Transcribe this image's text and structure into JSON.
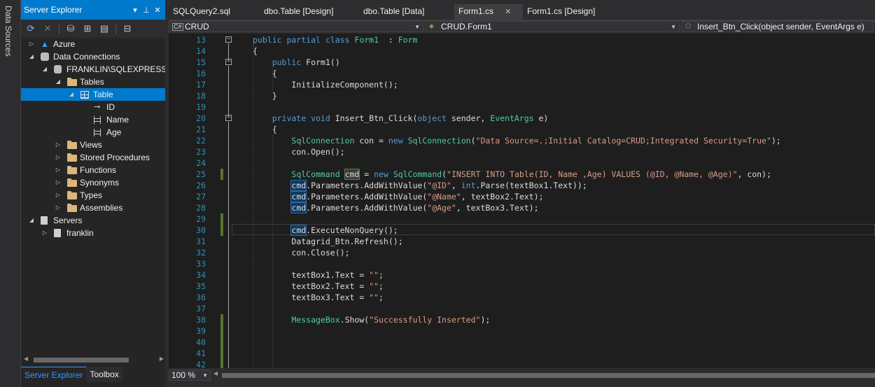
{
  "left_strip": {
    "data_sources": "Data Sources"
  },
  "server_explorer": {
    "title": "Server Explorer",
    "toolbar_icons": [
      "refresh-icon",
      "stop-icon",
      "connect-database-icon",
      "connect-server-icon",
      "sharepoint-icon",
      "properties-icon"
    ],
    "tree": [
      {
        "label": "Azure",
        "level": 0,
        "arrow": "collapsed",
        "icon": "azure-icon"
      },
      {
        "label": "Data Connections",
        "level": 0,
        "arrow": "expanded",
        "icon": "data-connections-icon"
      },
      {
        "label": "FRANKLIN\\SQLEXPRESS.C",
        "level": 1,
        "arrow": "expanded",
        "icon": "database-icon"
      },
      {
        "label": "Tables",
        "level": 2,
        "arrow": "expanded",
        "icon": "folder-icon"
      },
      {
        "label": "Table",
        "level": 3,
        "arrow": "expanded",
        "icon": "table-icon",
        "selected": true
      },
      {
        "label": "ID",
        "level": 4,
        "arrow": "none",
        "icon": "key-column-icon"
      },
      {
        "label": "Name",
        "level": 4,
        "arrow": "none",
        "icon": "column-icon"
      },
      {
        "label": "Age",
        "level": 4,
        "arrow": "none",
        "icon": "column-icon"
      },
      {
        "label": "Views",
        "level": 2,
        "arrow": "collapsed",
        "icon": "folder-icon"
      },
      {
        "label": "Stored Procedures",
        "level": 2,
        "arrow": "collapsed",
        "icon": "folder-icon"
      },
      {
        "label": "Functions",
        "level": 2,
        "arrow": "collapsed",
        "icon": "folder-icon"
      },
      {
        "label": "Synonyms",
        "level": 2,
        "arrow": "collapsed",
        "icon": "folder-icon"
      },
      {
        "label": "Types",
        "level": 2,
        "arrow": "collapsed",
        "icon": "folder-icon"
      },
      {
        "label": "Assemblies",
        "level": 2,
        "arrow": "collapsed",
        "icon": "folder-icon"
      },
      {
        "label": "Servers",
        "level": 0,
        "arrow": "expanded",
        "icon": "servers-icon"
      },
      {
        "label": "franklin",
        "level": 1,
        "arrow": "collapsed",
        "icon": "server-icon"
      }
    ],
    "bottom_tabs": [
      {
        "label": "Server Explorer",
        "active": true
      },
      {
        "label": "Toolbox",
        "active": false
      }
    ]
  },
  "document_tabs": [
    {
      "label": "SQLQuery2.sql",
      "active": false
    },
    {
      "label": "dbo.Table [Design]",
      "active": false
    },
    {
      "label": "dbo.Table [Data]",
      "active": false
    },
    {
      "label": "Form1.cs",
      "active": true,
      "close": "✕"
    },
    {
      "label": "Form1.cs [Design]",
      "active": false
    }
  ],
  "navigation": {
    "project": "CRUD",
    "class": "CRUD.Form1",
    "member": "Insert_Btn_Click(object sender, EventArgs e)"
  },
  "editor": {
    "line_numbers": [
      "13",
      "14",
      "15",
      "16",
      "17",
      "18",
      "19",
      "20",
      "21",
      "22",
      "23",
      "24",
      "25",
      "26",
      "27",
      "28",
      "29",
      "30",
      "31",
      "32",
      "33",
      "34",
      "35",
      "36",
      "37",
      "38",
      "39",
      "40",
      "41",
      "42"
    ],
    "code_lines": [
      [
        [
          "kw",
          "public partial class "
        ],
        [
          "ty",
          "Form1"
        ],
        [
          "",
          "  : "
        ],
        [
          "ty",
          "Form"
        ]
      ],
      [
        [
          "",
          "{"
        ]
      ],
      [
        [
          "kw",
          "    public "
        ],
        [
          "",
          "Form1()"
        ]
      ],
      [
        [
          "",
          "    {"
        ]
      ],
      [
        [
          "",
          "        InitializeComponent();"
        ]
      ],
      [
        [
          "",
          "    }"
        ]
      ],
      [
        [
          "",
          ""
        ]
      ],
      [
        [
          "kw",
          "    private void "
        ],
        [
          "",
          "Insert_Btn_Click("
        ],
        [
          "kw",
          "object"
        ],
        [
          "",
          " sender, "
        ],
        [
          "ty",
          "EventArgs"
        ],
        [
          "",
          " e)"
        ]
      ],
      [
        [
          "",
          "    {"
        ]
      ],
      [
        [
          "",
          "        "
        ],
        [
          "ty",
          "SqlConnection"
        ],
        [
          "",
          " con = "
        ],
        [
          "kw",
          "new "
        ],
        [
          "ty",
          "SqlConnection"
        ],
        [
          "",
          "("
        ],
        [
          "st",
          "\"Data Source=.;Initial Catalog=CRUD;Integrated Security=True\""
        ],
        [
          "",
          ");"
        ]
      ],
      [
        [
          "",
          "        con.Open();"
        ]
      ],
      [
        [
          "",
          ""
        ]
      ],
      [
        [
          "",
          "        "
        ],
        [
          "ty",
          "SqlCommand "
        ],
        [
          "hl",
          "cmd"
        ],
        [
          "",
          " = "
        ],
        [
          "kw",
          "new "
        ],
        [
          "ty",
          "SqlCommand"
        ],
        [
          "",
          "("
        ],
        [
          "st",
          "\"INSERT INTO Table(ID, Name ,Age) VALUES (@ID, @Name, @Age)\""
        ],
        [
          "",
          ", con);"
        ]
      ],
      [
        [
          "",
          "        "
        ],
        [
          "ref",
          "cmd"
        ],
        [
          "",
          ".Parameters.AddWithValue("
        ],
        [
          "st",
          "\"@ID\""
        ],
        [
          "",
          ", "
        ],
        [
          "kw",
          "int"
        ],
        [
          "",
          ".Parse(textBox1.Text));"
        ]
      ],
      [
        [
          "",
          "        "
        ],
        [
          "ref",
          "cmd"
        ],
        [
          "",
          ".Parameters.AddWithValue("
        ],
        [
          "st",
          "\"@Name\""
        ],
        [
          "",
          ", textBox2.Text);"
        ]
      ],
      [
        [
          "",
          "        "
        ],
        [
          "ref",
          "cmd"
        ],
        [
          "",
          ".Parameters.AddWithValue("
        ],
        [
          "st",
          "\"@Age\""
        ],
        [
          "",
          ", textBox3.Text);"
        ]
      ],
      [
        [
          "",
          ""
        ]
      ],
      [
        [
          "",
          "        "
        ],
        [
          "ref",
          "cmd"
        ],
        [
          "",
          ".ExecuteNonQuery();"
        ]
      ],
      [
        [
          "",
          "        Datagrid_Btn.Refresh();"
        ]
      ],
      [
        [
          "",
          "        con.Close();"
        ]
      ],
      [
        [
          "",
          ""
        ]
      ],
      [
        [
          "",
          "        textBox1.Text = "
        ],
        [
          "st",
          "\"\""
        ],
        [
          "",
          ";"
        ]
      ],
      [
        [
          "",
          "        textBox2.Text = "
        ],
        [
          "st",
          "\"\""
        ],
        [
          "",
          ";"
        ]
      ],
      [
        [
          "",
          "        textBox3.Text = "
        ],
        [
          "st",
          "\"\""
        ],
        [
          "",
          ";"
        ]
      ],
      [
        [
          "",
          ""
        ]
      ],
      [
        [
          "",
          "        "
        ],
        [
          "ty",
          "MessageBox"
        ],
        [
          "",
          ".Show("
        ],
        [
          "st",
          "\"Successfully Inserted\""
        ],
        [
          "",
          ");"
        ]
      ],
      [
        [
          "",
          ""
        ]
      ],
      [
        [
          "",
          ""
        ]
      ],
      [
        [
          "",
          ""
        ]
      ],
      [
        [
          "",
          ""
        ]
      ]
    ]
  },
  "zoom": "100 %",
  "colors": {
    "accent": "#007acc",
    "keyword": "#569cd6",
    "type": "#4ec9b0",
    "string": "#d69d85",
    "line_number": "#2b91af",
    "background": "#1e1e1e"
  }
}
